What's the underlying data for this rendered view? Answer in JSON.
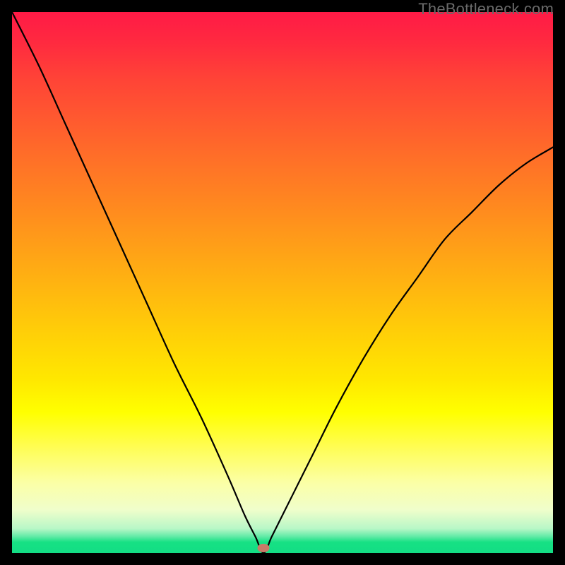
{
  "watermark": "TheBottleneck.com",
  "marker": {
    "x_pct": 46.5,
    "y_pct": 99.1
  },
  "chart_data": {
    "type": "line",
    "title": "",
    "xlabel": "",
    "ylabel": "",
    "xlim": [
      0,
      100
    ],
    "ylim": [
      0,
      100
    ],
    "series": [
      {
        "name": "bottleneck-curve",
        "x": [
          0,
          5,
          10,
          15,
          20,
          25,
          30,
          35,
          40,
          43,
          45,
          46.5,
          48,
          50,
          53,
          56,
          60,
          65,
          70,
          75,
          80,
          85,
          90,
          95,
          100
        ],
        "y": [
          100,
          90,
          79,
          68,
          57,
          46,
          35,
          25,
          14,
          7,
          3,
          0,
          3,
          7,
          13,
          19,
          27,
          36,
          44,
          51,
          58,
          63,
          68,
          72,
          75
        ]
      }
    ],
    "background_gradient": {
      "direction": "top-to-bottom",
      "stops": [
        {
          "pct": 0,
          "color": "#ff1a46"
        },
        {
          "pct": 50,
          "color": "#ffb012"
        },
        {
          "pct": 72,
          "color": "#fff500"
        },
        {
          "pct": 88,
          "color": "#fcffb0"
        },
        {
          "pct": 96,
          "color": "#8cf0b0"
        },
        {
          "pct": 100,
          "color": "#13dd85"
        }
      ]
    },
    "marker_point": {
      "x": 46.5,
      "y": 0,
      "color": "#c97a68"
    }
  }
}
